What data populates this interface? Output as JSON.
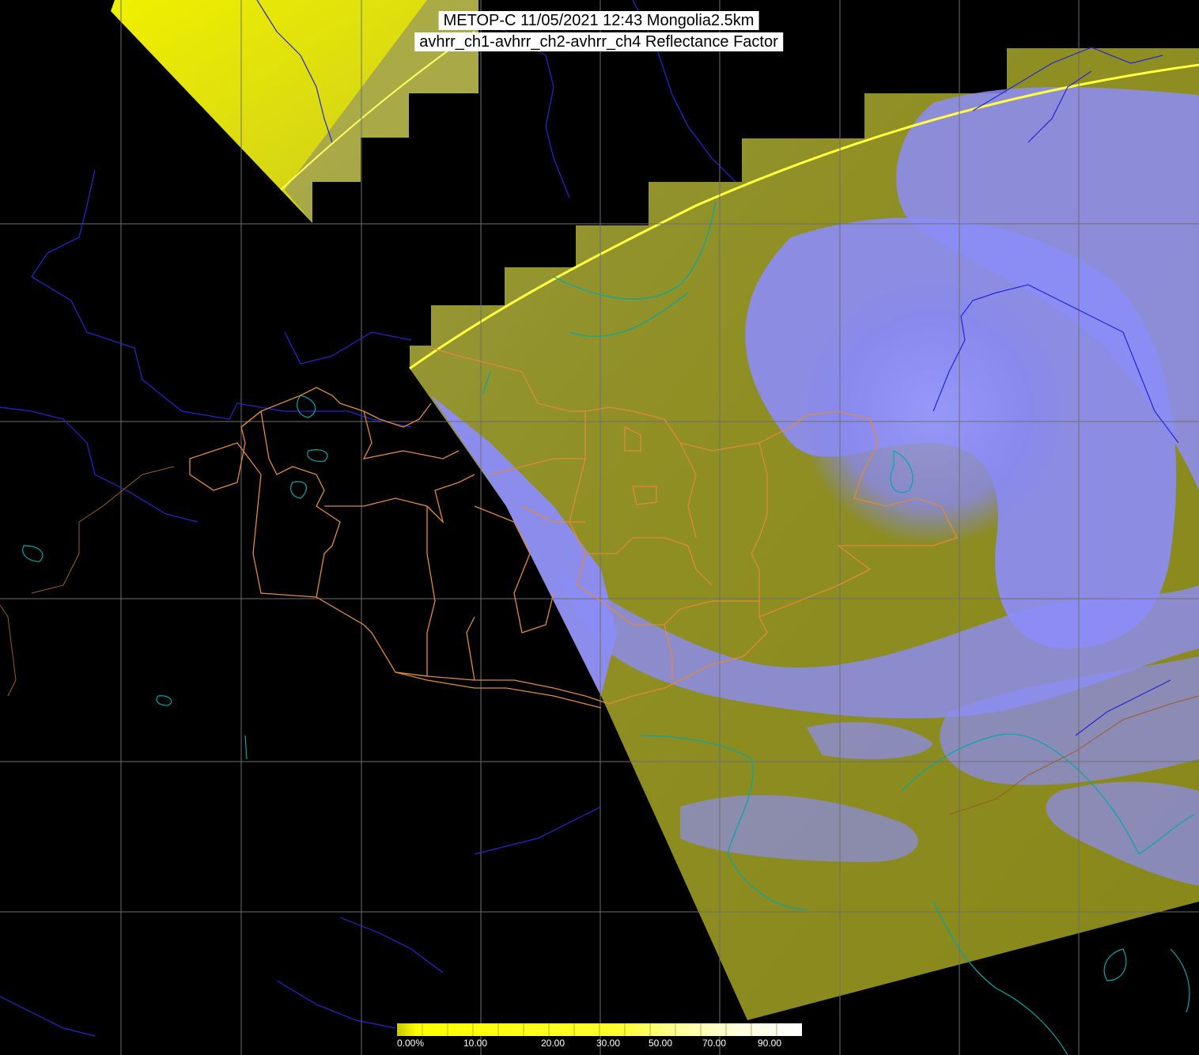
{
  "title": {
    "line1": "METOP-C 11/05/2021 12:43 Mongolia2.5km",
    "line2": "avhrr_ch1-avhrr_ch2-avhrr_ch4 Reflectance Factor"
  },
  "colorbar": {
    "ticks": [
      "0.00%",
      "10.00",
      "20.00",
      "30.00",
      "50.00",
      "70.00",
      "90.00"
    ],
    "colors": [
      "#ffff00",
      "#ffff00",
      "#ffff00",
      "#ffff33",
      "#ffff99",
      "#ffffcc",
      "#ffffff"
    ]
  },
  "colors": {
    "background": "#000000",
    "ground": "#8f8f16",
    "cloud": "#8f8fff",
    "swath_edge": "#ffff00",
    "graticule": "#6e6e6e",
    "rivers": "#2020d0",
    "coastline": "#00a0a0",
    "admin_boundaries": "#e08a3a"
  }
}
